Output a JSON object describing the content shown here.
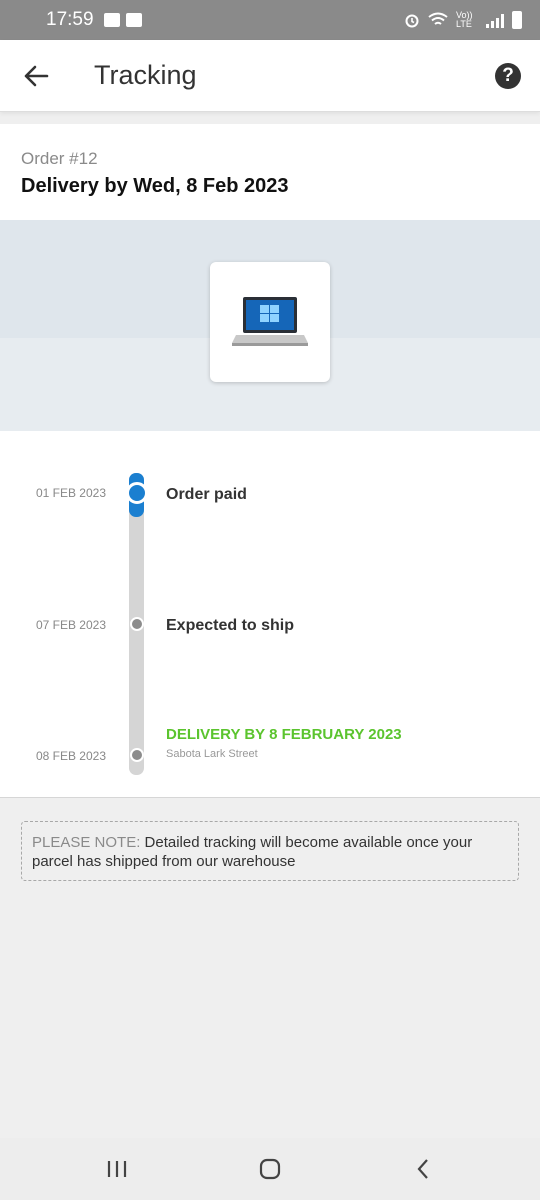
{
  "status_bar": {
    "time": "17:59",
    "network_label": "Vo)) LTE"
  },
  "app_bar": {
    "title": "Tracking",
    "back_icon": "arrow-left-icon",
    "help_icon": "help-circle-icon"
  },
  "order": {
    "number": "Order #12",
    "delivery_by": "Delivery by Wed, 8 Feb 2023",
    "product_image": "laptop-icon"
  },
  "timeline": {
    "progress_color": "#1b7fd0",
    "delivery_color": "#5bc42e",
    "steps": [
      {
        "date": "01 FEB 2023",
        "label": "Order paid",
        "state": "completed"
      },
      {
        "date": "07 FEB 2023",
        "label": "Expected to ship",
        "state": "pending"
      },
      {
        "date": "08 FEB 2023",
        "label": "DELIVERY BY 8 FEBRUARY 2023",
        "address": "Sabota Lark Street",
        "state": "pending"
      }
    ]
  },
  "note": {
    "label": "PLEASE NOTE:",
    "text": " Detailed tracking will become available once your parcel has shipped from our warehouse"
  },
  "nav_bar": {
    "recents_icon": "recents-icon",
    "home_icon": "home-icon",
    "back_icon": "nav-back-icon"
  }
}
